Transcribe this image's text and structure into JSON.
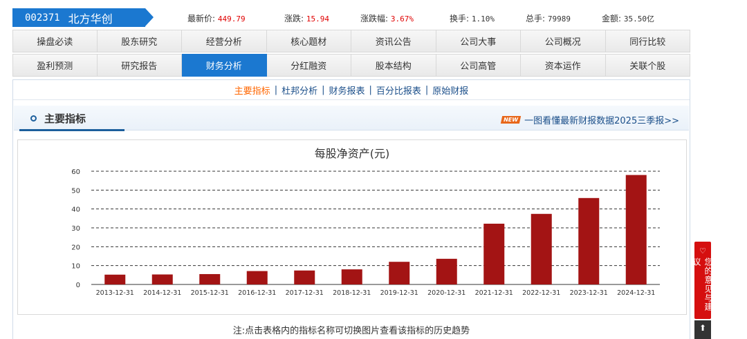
{
  "stock": {
    "code": "002371",
    "name": "北方华创"
  },
  "quote": {
    "price_label": "最新价:",
    "price": "449.79",
    "change_label": "涨跌:",
    "change": "15.94",
    "pct_label": "涨跌幅:",
    "pct": "3.67%",
    "turnover_label": "换手:",
    "turnover": "1.10%",
    "volume_label": "总手:",
    "volume": "79989",
    "amount_label": "金额:",
    "amount": "35.50亿"
  },
  "nav_row1": [
    "操盘必读",
    "股东研究",
    "经营分析",
    "核心题材",
    "资讯公告",
    "公司大事",
    "公司概况",
    "同行比较"
  ],
  "nav_row2": [
    "盈利预测",
    "研究报告",
    "财务分析",
    "分红融资",
    "股本结构",
    "公司高管",
    "资本运作",
    "关联个股"
  ],
  "nav_active": "财务分析",
  "subnav": [
    "主要指标",
    "杜邦分析",
    "财务报表",
    "百分比报表",
    "原始财报"
  ],
  "subnav_sep": "|",
  "section": {
    "title": "主要指标",
    "badge": "NEW",
    "promo": "一图看懂最新财报数据2025三季报>>"
  },
  "chart_data": {
    "type": "bar",
    "title": "每股净资产(元)",
    "categories": [
      "2013-12-31",
      "2014-12-31",
      "2015-12-31",
      "2016-12-31",
      "2017-12-31",
      "2018-12-31",
      "2019-12-31",
      "2020-12-31",
      "2021-12-31",
      "2022-12-31",
      "2023-12-31",
      "2024-12-31"
    ],
    "values": [
      5.2,
      5.3,
      5.5,
      7.1,
      7.4,
      8.0,
      12.0,
      13.6,
      32.2,
      37.4,
      45.8,
      58.0
    ],
    "ylim": [
      0,
      60
    ],
    "yticks": [
      0,
      10,
      20,
      30,
      40,
      50,
      60
    ],
    "grid": true,
    "bar_color": "#a31414"
  },
  "note": "注:点击表格内的指标名称可切换图片查看该指标的历史趋势",
  "feedback": {
    "icon": "♡",
    "text": "您的意见与建议"
  },
  "totop": "⬆"
}
